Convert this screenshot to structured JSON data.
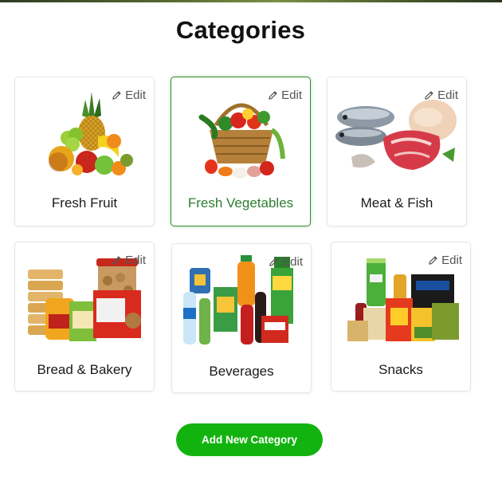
{
  "page": {
    "title": "Categories"
  },
  "edit_label": "Edit",
  "categories": [
    {
      "name": "Fresh Fruit",
      "icon": "fruit-basket-image"
    },
    {
      "name": "Fresh Vegetables",
      "icon": "vegetable-basket-image",
      "selected": true
    },
    {
      "name": "Meat & Fish",
      "icon": "meat-fish-image"
    },
    {
      "name": "Bread & Bakery",
      "icon": "bread-bakery-image"
    },
    {
      "name": "Beverages",
      "icon": "beverages-image"
    },
    {
      "name": "Snacks",
      "icon": "snacks-image"
    }
  ],
  "actions": {
    "add_new": "Add New Category"
  },
  "colors": {
    "accent": "#13b30f",
    "selected_border": "#2f8f2f",
    "selected_text": "#2e7d32"
  }
}
